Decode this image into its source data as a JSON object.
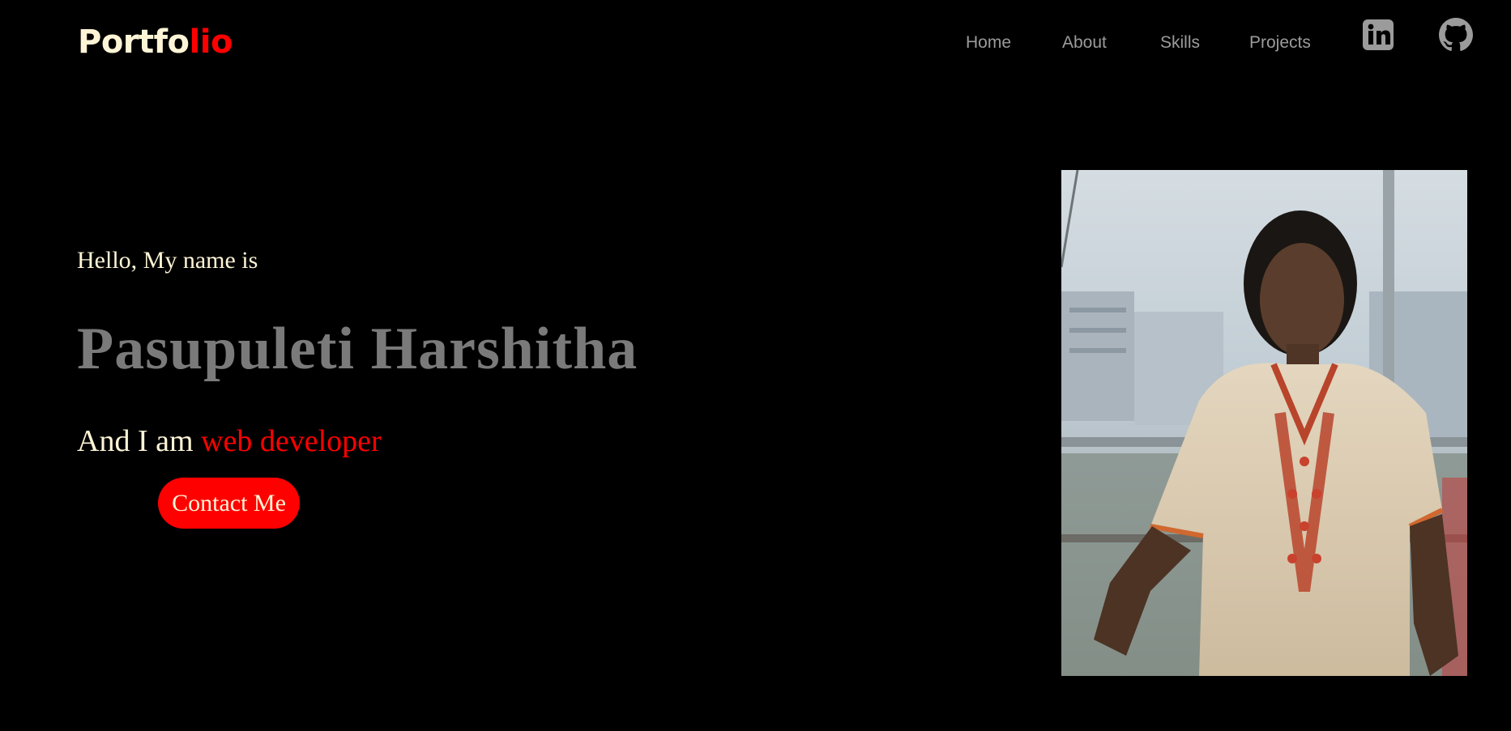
{
  "header": {
    "logo_main": "Portfo",
    "logo_accent": "lio",
    "nav": [
      {
        "label": "Home"
      },
      {
        "label": "About"
      },
      {
        "label": "Skills"
      },
      {
        "label": "Projects"
      }
    ],
    "social": [
      {
        "icon": "linkedin-icon"
      },
      {
        "icon": "github-icon"
      }
    ]
  },
  "hero": {
    "greeting": "Hello, My name is",
    "name": "Pasupuleti Harshitha",
    "role_prefix": "And I am ",
    "role": "web developer",
    "cta_label": "Contact Me"
  },
  "colors": {
    "background": "#000000",
    "accent": "#ff0000",
    "text_light": "#fff5d6",
    "name_gray": "#7a7a7a",
    "nav_gray": "#9b9b9b"
  }
}
